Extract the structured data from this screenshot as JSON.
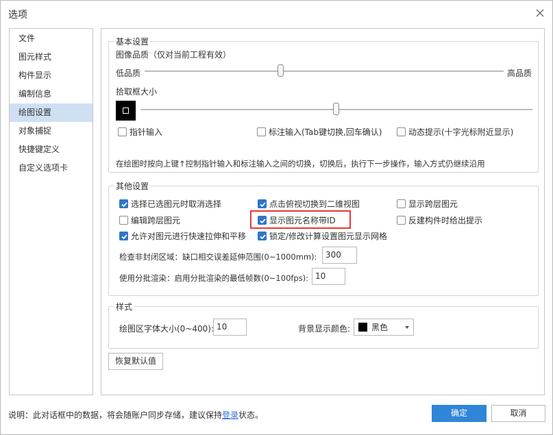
{
  "window": {
    "title": "选项"
  },
  "sidebar": {
    "items": [
      {
        "label": "文件"
      },
      {
        "label": "图元样式"
      },
      {
        "label": "构件显示"
      },
      {
        "label": "编制信息"
      },
      {
        "label": "绘图设置"
      },
      {
        "label": "对象捕捉"
      },
      {
        "label": "快捷键定义"
      },
      {
        "label": "自定义选项卡"
      }
    ],
    "active": "绘图设置"
  },
  "basic": {
    "title": "基本设置",
    "quality_label": "图像品质（仅对当前工程有效）",
    "low": "低品质",
    "high": "高品质",
    "quality_level": 0.38,
    "pick_label": "拾取框大小",
    "pick_level": 0.5,
    "cb_pointer": "指针输入",
    "cb_dim": "标注输入(Tab键切换,回车确认)",
    "cb_dynamic": "动态提示(十字光标附近显示)",
    "note": "在绘图时按向上键↑控制指针输入和标注输入之间的切换，切换后，执行下一步操作，输入方式仍继续沿用"
  },
  "other": {
    "title": "其他设置",
    "cb1": "选择已选图元时取消选择",
    "cb2": "点击俯视切换到二维视图",
    "cb3": "显示跨层图元",
    "cb4": "编辑跨层图元",
    "cb5": "显示图元名称带ID",
    "cb6": "反建构件时给出提示",
    "cb7": "允许对图元进行快速拉伸和平移",
    "cb8": "锁定/修改计算设置图元显示网格",
    "check_label": "检查非封闭区域：缺口相交误差延伸范围(0~1000mm):",
    "check_value": "300",
    "batch_label": "使用分批渲染：启用分批渲染的最低帧数(0~100fps):",
    "batch_value": "10"
  },
  "style": {
    "title": "样式",
    "font_label": "绘图区字体大小(0~400):",
    "font_value": "10",
    "bg_label": "背景显示颜色:",
    "bg_value": "黑色",
    "bg_color": "#000000"
  },
  "restore_label": "恢复默认值",
  "footer": {
    "note_prefix": "说明：此对话框中的数据，将会随账户同步存储，建议保持",
    "note_link": "登录",
    "note_suffix": "状态。",
    "ok": "确定",
    "cancel": "取消"
  },
  "colors": {
    "accent": "#2f86d8",
    "active_bg": "#cfe0f3",
    "highlight": "#e53935"
  }
}
